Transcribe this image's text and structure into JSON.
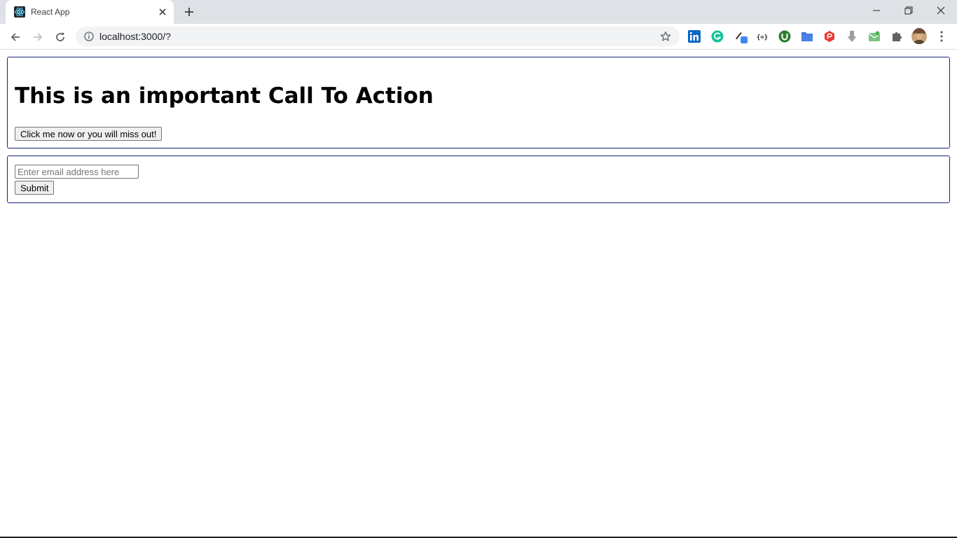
{
  "browser": {
    "tab": {
      "title": "React App",
      "favicon": "react-logo-icon"
    },
    "address_bar": {
      "url": "localhost:3000/?"
    },
    "extensions": [
      "linkedin-icon",
      "grammarly-icon",
      "pen-tool-icon",
      "json-formatter-icon",
      "utorrent-icon",
      "folder-icon",
      "pdf-icon",
      "download-icon",
      "mail-icon",
      "puzzle-icon",
      "avatar",
      "more-icon"
    ],
    "colors": {
      "tabstrip": "#dee1e6",
      "omnibox": "#f1f3f4",
      "linkedin": "#0a66c2",
      "grammarly": "#15c39a"
    }
  },
  "page": {
    "cta": {
      "heading": "This is an important Call To Action",
      "button_label": "Click me now or you will miss out!"
    },
    "form": {
      "email_placeholder": "Enter email address here",
      "email_value": "",
      "submit_label": "Submit"
    },
    "colors": {
      "box_border": "#1a237e"
    }
  }
}
